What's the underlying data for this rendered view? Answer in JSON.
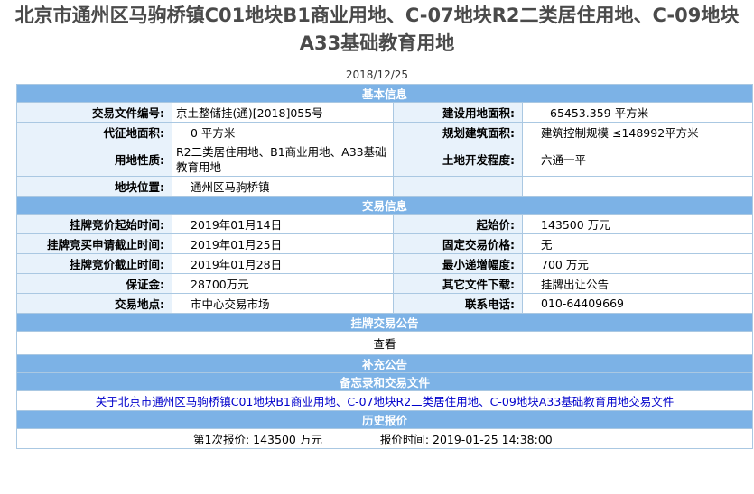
{
  "title": "北京市通州区马驹桥镇C01地块B1商业用地、C-07地块R2二类居住用地、C-09地块A33基础教育用地",
  "date": "2018/12/25",
  "sections": {
    "basic": "基本信息",
    "trade": "交易信息",
    "announcement": "挂牌交易公告",
    "supplement": "补充公告",
    "memo": "备忘录和交易文件",
    "history": "历史报价"
  },
  "basic": {
    "file_no_label": "交易文件编号:",
    "file_no": "京土整储挂(通)[2018]055号",
    "construction_area_label": "建设用地面积:",
    "construction_area": "65453.359 平方米",
    "levy_area_label": "代征地面积:",
    "levy_area": "0 平方米",
    "planned_area_label": "规划建筑面积:",
    "planned_area": "建筑控制规模 ≤148992平方米",
    "land_use_label": "用地性质:",
    "land_use": "R2二类居住用地、B1商业用地、A33基础教育用地",
    "development_label": "土地开发程度:",
    "development": "六通一平",
    "location_label": "地块位置:",
    "location": "通州区马驹桥镇"
  },
  "trade": {
    "start_time_label": "挂牌竞价起始时间:",
    "start_time": "2019年01月14日",
    "start_price_label": "起始价:",
    "start_price": "143500 万元",
    "apply_deadline_label": "挂牌竞买申请截止时间:",
    "apply_deadline": "2019年01月25日",
    "fixed_price_label": "固定交易价格:",
    "fixed_price": "无",
    "bid_deadline_label": "挂牌竞价截止时间:",
    "bid_deadline": "2019年01月28日",
    "min_increment_label": "最小递增幅度:",
    "min_increment": "700 万元",
    "deposit_label": "保证金:",
    "deposit": "28700万元",
    "other_files_label": "其它文件下载:",
    "other_files": "挂牌出让公告",
    "place_label": "交易地点:",
    "place": "市中心交易市场",
    "phone_label": "联系电话:",
    "phone": "010-64409669"
  },
  "announcement": {
    "view": "查看"
  },
  "memo": {
    "link": "关于北京市通州区马驹桥镇C01地块B1商业用地、C-07地块R2二类居住用地、C-09地块A33基础教育用地交易文件"
  },
  "history": {
    "quote": "第1次报价: 143500 万元",
    "quote_time": "报价时间: 2019-01-25 14:38:00"
  },
  "colors": {
    "section_bg": "#7cb2e6",
    "label_bg": "#e8f2fb",
    "border": "#aac8e2",
    "link": "#0000cc"
  }
}
